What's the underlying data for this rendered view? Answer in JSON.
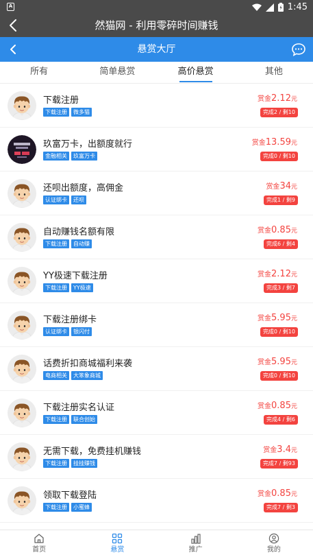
{
  "status": {
    "time": "1:45",
    "notif": "A"
  },
  "app": {
    "title": "然猫网 - 利用零碎时间赚钱"
  },
  "header": {
    "title": "悬赏大厅"
  },
  "tabs": [
    "所有",
    "简单悬赏",
    "高价悬赏",
    "其他"
  ],
  "active_tab": 2,
  "reward_label": "赏金",
  "reward_unit": "元",
  "tasks": [
    {
      "title": "下载注册",
      "tags": [
        "下载注册",
        "微多猫"
      ],
      "amount": "2.12",
      "progress": "完成2 / 剩10",
      "avatar": "cartoon"
    },
    {
      "title": "玖富万卡，出额度就行",
      "tags": [
        "金融相关",
        "玖富万卡"
      ],
      "amount": "13.59",
      "progress": "完成0 / 剩10",
      "avatar": "dark"
    },
    {
      "title": "还呗出额度，高佣金",
      "tags": [
        "认证绑卡",
        "还呗"
      ],
      "amount": "34",
      "progress": "完成1 / 剩9",
      "avatar": "cartoon"
    },
    {
      "title": "自动赚钱名额有限",
      "tags": [
        "下载注册",
        "自动赚"
      ],
      "amount": "0.85",
      "progress": "完成6 / 剩4",
      "avatar": "cartoon"
    },
    {
      "title": "YY极速下载注册",
      "tags": [
        "下载注册",
        "YY极速"
      ],
      "amount": "2.12",
      "progress": "完成3 / 剩7",
      "avatar": "cartoon"
    },
    {
      "title": "下载注册绑卡",
      "tags": [
        "认证绑卡",
        "银闪付"
      ],
      "amount": "5.95",
      "progress": "完成0 / 剩10",
      "avatar": "cartoon"
    },
    {
      "title": "话费折扣商城福利来袭",
      "tags": [
        "电商相关",
        "大笨象商城"
      ],
      "amount": "5.95",
      "progress": "完成0 / 剩10",
      "avatar": "cartoon"
    },
    {
      "title": "下载注册实名认证",
      "tags": [
        "下载注册",
        "联合创始"
      ],
      "amount": "0.85",
      "progress": "完成4 / 剩6",
      "avatar": "cartoon"
    },
    {
      "title": "无需下载，免费挂机赚钱",
      "tags": [
        "下载注册",
        "挂挂赚钱"
      ],
      "amount": "3.4",
      "progress": "完成7 / 剩93",
      "avatar": "cartoon"
    },
    {
      "title": "领取下载登陆",
      "tags": [
        "下载注册",
        "小蜜蜂"
      ],
      "amount": "0.85",
      "progress": "完成7 / 剩3",
      "avatar": "cartoon"
    }
  ],
  "bottom_nav": [
    {
      "label": "首页",
      "icon": "home-icon"
    },
    {
      "label": "悬赏",
      "icon": "grid-icon"
    },
    {
      "label": "推广",
      "icon": "bar-chart-icon"
    },
    {
      "label": "我的",
      "icon": "user-icon"
    }
  ],
  "active_nav": 1,
  "colors": {
    "topbar": "#4a4a4a",
    "accent": "#2e8be8",
    "reward": "#f3433f"
  }
}
